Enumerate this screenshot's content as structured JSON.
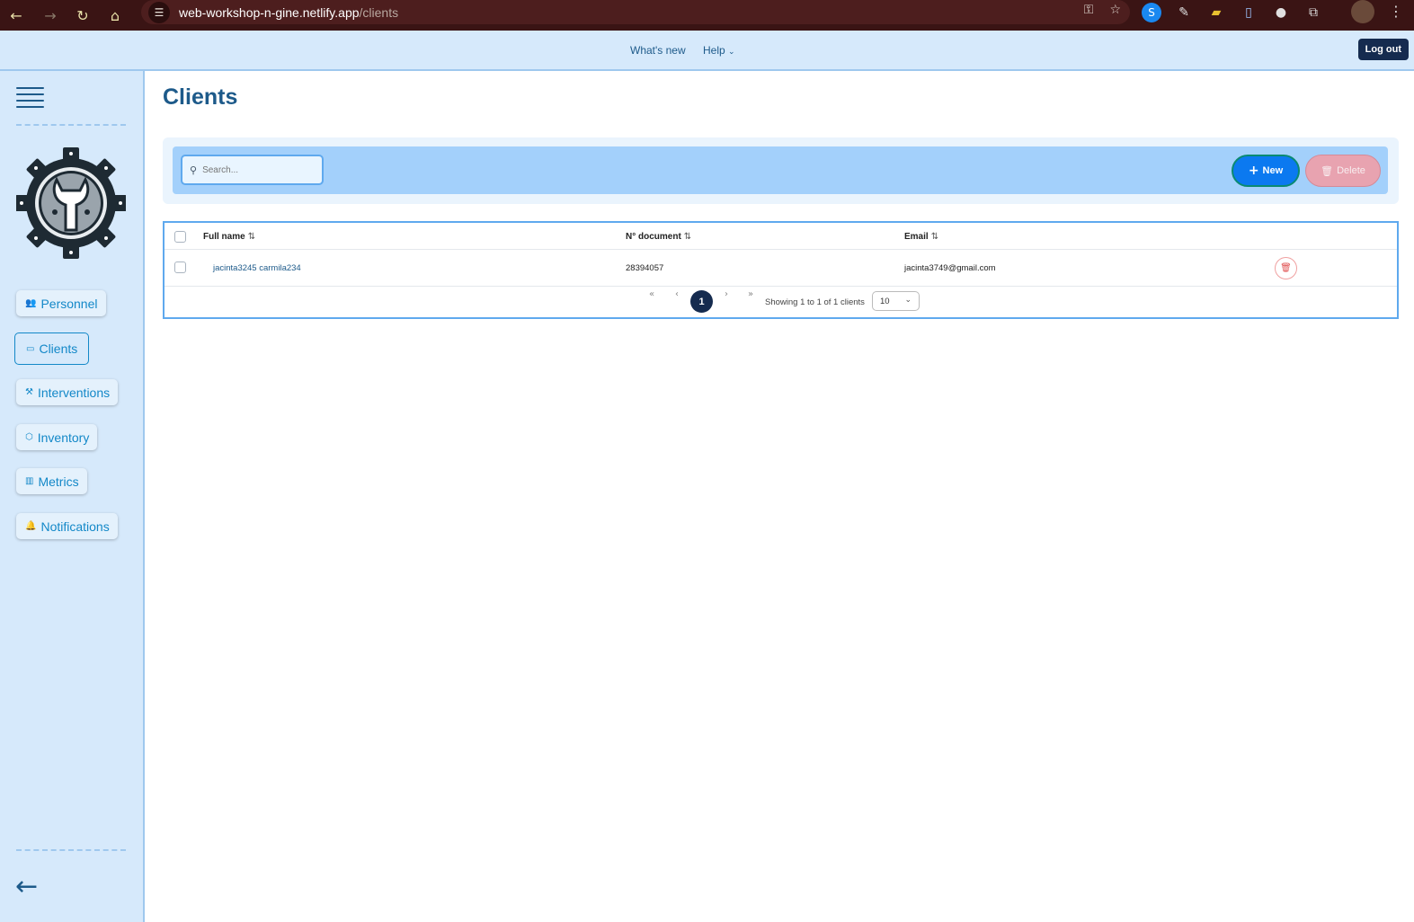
{
  "browser": {
    "url_host": "web-workshop-n-gine.netlify.app",
    "url_path": "/clients"
  },
  "header": {
    "whats_new": "What's new",
    "help": "Help",
    "logout": "Log out"
  },
  "sidebar": {
    "items": [
      {
        "label": "Personnel",
        "icon": "users-icon"
      },
      {
        "label": "Clients",
        "icon": "id-card-icon",
        "active": true
      },
      {
        "label": "Interventions",
        "icon": "wrench-icon"
      },
      {
        "label": "Inventory",
        "icon": "box-icon"
      },
      {
        "label": "Metrics",
        "icon": "bar-chart-icon"
      },
      {
        "label": "Notifications",
        "icon": "bell-icon"
      }
    ]
  },
  "page": {
    "title": "Clients"
  },
  "toolbar": {
    "search_placeholder": "Search...",
    "new_label": "New",
    "delete_label": "Delete"
  },
  "table": {
    "columns": [
      "Full name",
      "N° document",
      "Email"
    ],
    "rows": [
      {
        "full_name": "jacinta3245 carmila234",
        "document": "28394057",
        "email": "jacinta3749@gmail.com"
      }
    ],
    "pagination": {
      "current_page": "1",
      "showing": "Showing 1 to 1 of 1 clients",
      "per_page": "10"
    }
  },
  "colors": {
    "accent": "#1d5a8a",
    "primary_button": "#0b79f0",
    "danger": "#e8a3b0",
    "sidebar_bg": "#d6e9fb"
  }
}
